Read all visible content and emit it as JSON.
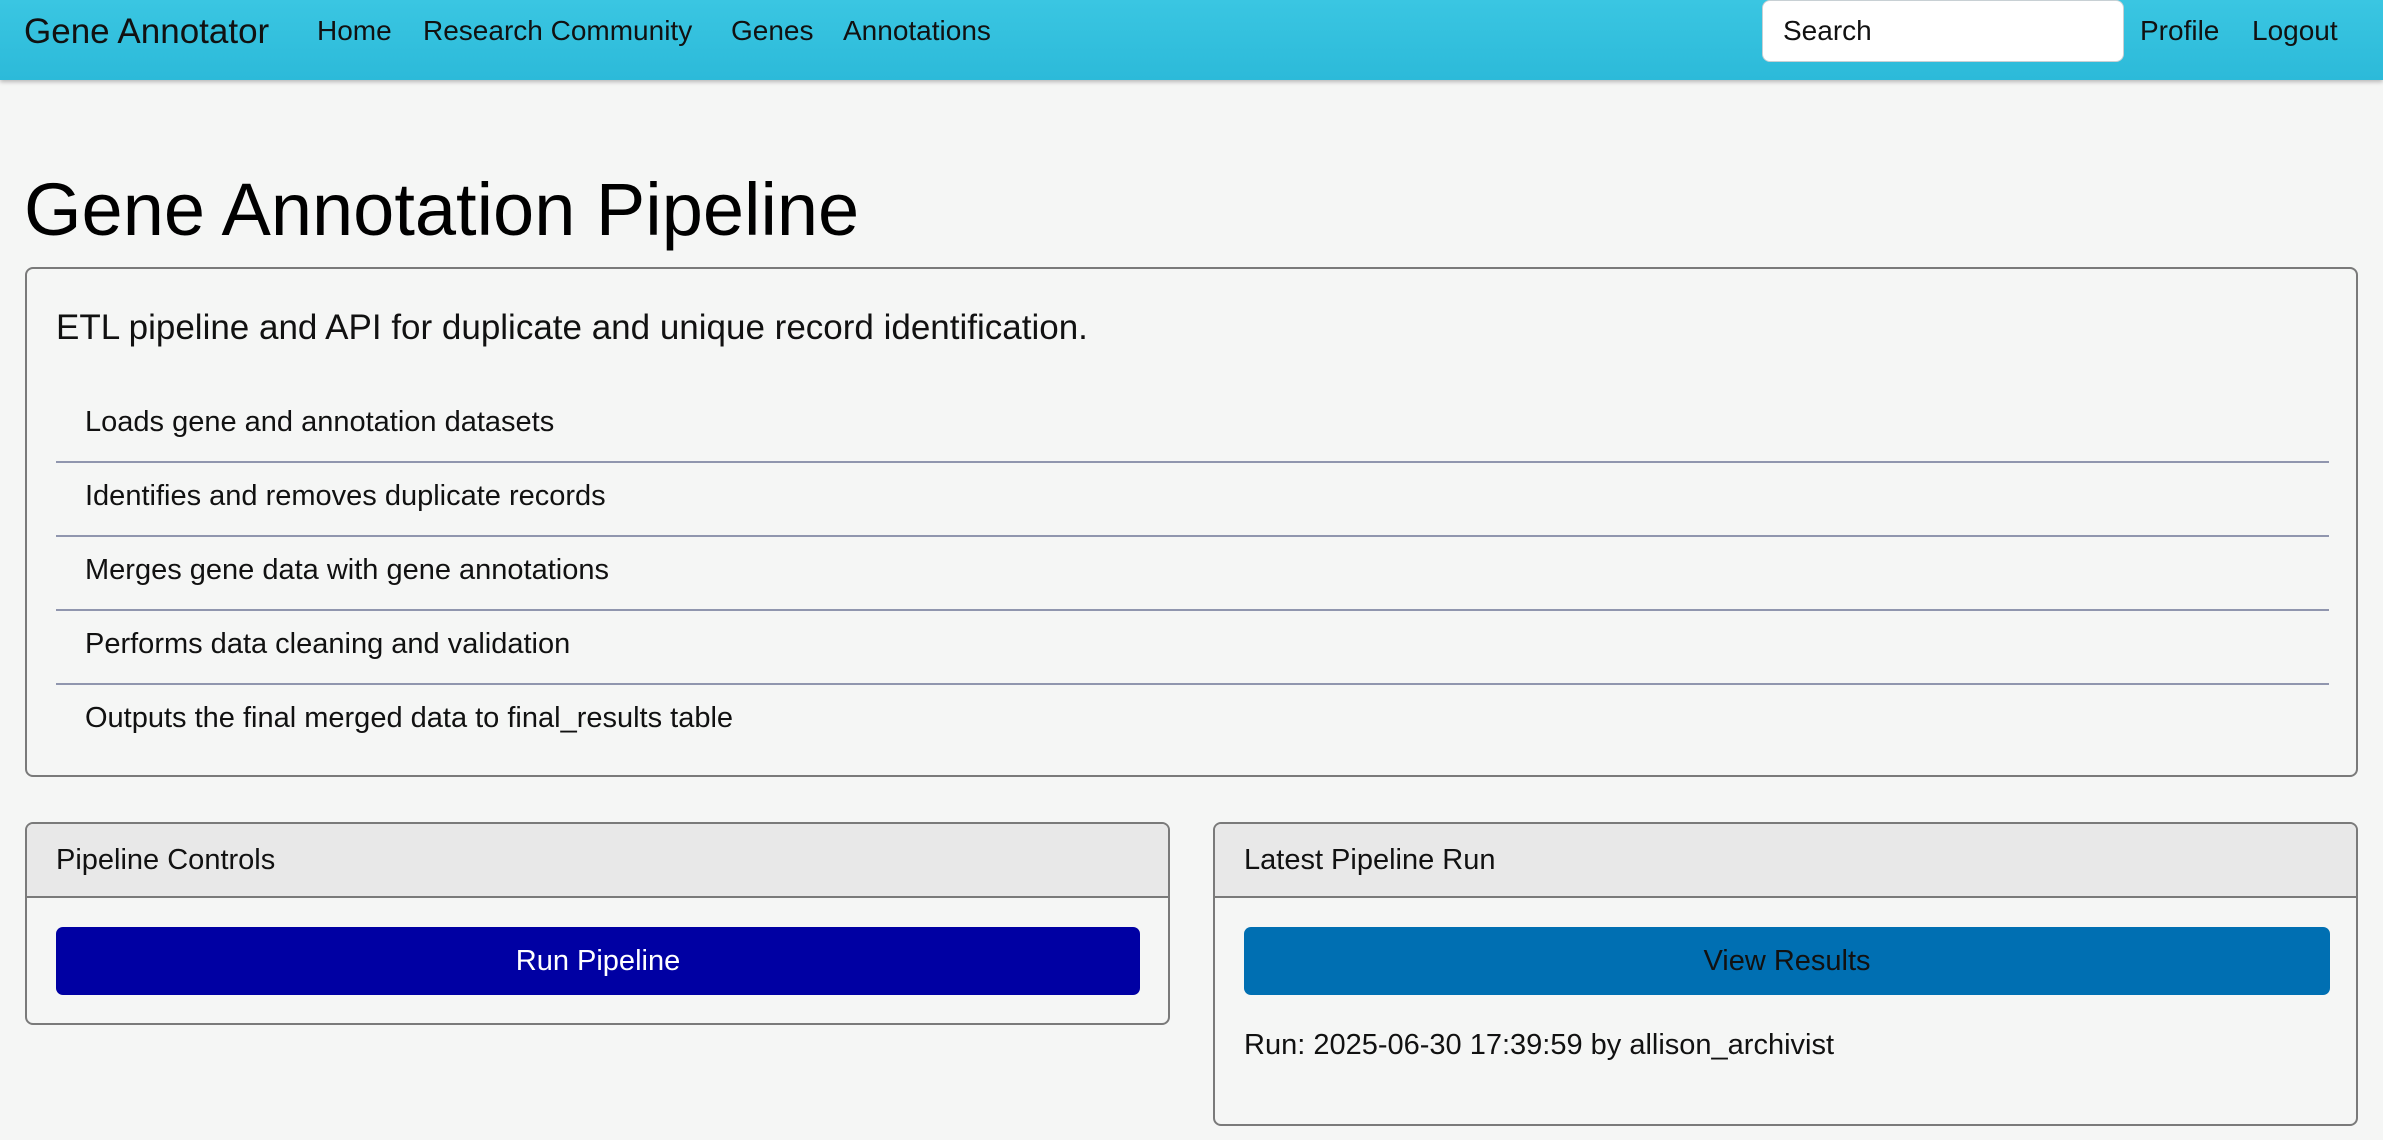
{
  "navbar": {
    "brand": "Gene Annotator",
    "links": [
      "Home",
      "Research Community",
      "Genes",
      "Annotations"
    ],
    "search_placeholder": "Search",
    "profile": "Profile",
    "logout": "Logout",
    "bg_color": "#33c1de"
  },
  "main": {
    "title": "Gene Annotation Pipeline",
    "lead": "ETL pipeline and API for duplicate and unique record identification.",
    "features": [
      "Loads gene and annotation datasets",
      "Identifies and removes duplicate records",
      "Merges gene data with gene annotations",
      "Performs data cleaning and validation",
      "Outputs the final merged data to final_results table"
    ]
  },
  "controls": {
    "header": "Pipeline Controls",
    "run_button": "Run Pipeline",
    "run_button_color": "#0000a3"
  },
  "latest_run": {
    "header": "Latest Pipeline Run",
    "view_button": "View Results",
    "view_button_color": "#006fb2",
    "run_info": "Run: 2025-06-30 17:39:59 by allison_archivist"
  }
}
